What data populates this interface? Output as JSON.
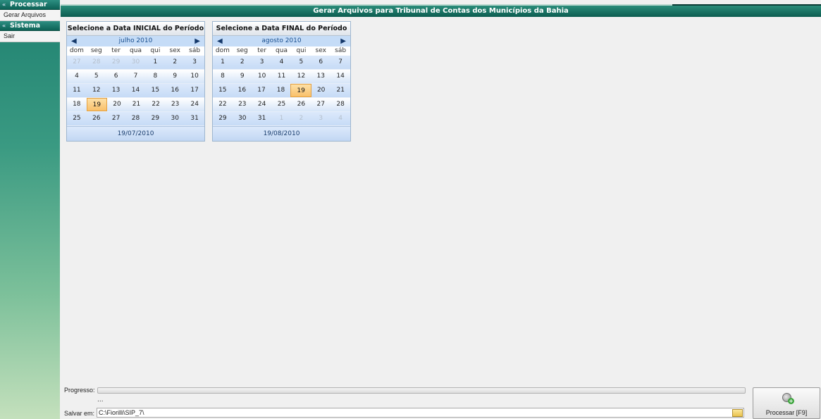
{
  "window": {
    "title": "Gerar Arquivos para Tribunal de Contas dos Municípios da Bahia"
  },
  "sidebar": {
    "groups": [
      {
        "label": "Processar",
        "items": [
          {
            "label": "Gerar Arquivos"
          }
        ]
      },
      {
        "label": "Sistema",
        "items": [
          {
            "label": "Sair"
          }
        ]
      }
    ]
  },
  "calendars": {
    "start": {
      "header": "Selecione a Data INICIAL do Período",
      "month": "julho 2010",
      "weekdays": [
        "dom",
        "seg",
        "ter",
        "qua",
        "qui",
        "sex",
        "sáb"
      ],
      "weeks": [
        [
          {
            "d": "27",
            "o": true
          },
          {
            "d": "28",
            "o": true
          },
          {
            "d": "29",
            "o": true
          },
          {
            "d": "30",
            "o": true
          },
          {
            "d": "1"
          },
          {
            "d": "2"
          },
          {
            "d": "3"
          }
        ],
        [
          {
            "d": "4"
          },
          {
            "d": "5"
          },
          {
            "d": "6"
          },
          {
            "d": "7"
          },
          {
            "d": "8"
          },
          {
            "d": "9"
          },
          {
            "d": "10"
          }
        ],
        [
          {
            "d": "11"
          },
          {
            "d": "12"
          },
          {
            "d": "13"
          },
          {
            "d": "14"
          },
          {
            "d": "15"
          },
          {
            "d": "16"
          },
          {
            "d": "17"
          }
        ],
        [
          {
            "d": "18"
          },
          {
            "d": "19",
            "s": true
          },
          {
            "d": "20"
          },
          {
            "d": "21"
          },
          {
            "d": "22"
          },
          {
            "d": "23"
          },
          {
            "d": "24"
          }
        ],
        [
          {
            "d": "25"
          },
          {
            "d": "26"
          },
          {
            "d": "27"
          },
          {
            "d": "28"
          },
          {
            "d": "29"
          },
          {
            "d": "30"
          },
          {
            "d": "31"
          }
        ]
      ],
      "selected_date": "19/07/2010"
    },
    "end": {
      "header": "Selecione a Data FINAL do Período",
      "month": "agosto 2010",
      "weekdays": [
        "dom",
        "seg",
        "ter",
        "qua",
        "qui",
        "sex",
        "sáb"
      ],
      "weeks": [
        [
          {
            "d": "1"
          },
          {
            "d": "2"
          },
          {
            "d": "3"
          },
          {
            "d": "4"
          },
          {
            "d": "5"
          },
          {
            "d": "6"
          },
          {
            "d": "7"
          }
        ],
        [
          {
            "d": "8"
          },
          {
            "d": "9"
          },
          {
            "d": "10"
          },
          {
            "d": "11"
          },
          {
            "d": "12"
          },
          {
            "d": "13"
          },
          {
            "d": "14"
          }
        ],
        [
          {
            "d": "15"
          },
          {
            "d": "16"
          },
          {
            "d": "17"
          },
          {
            "d": "18"
          },
          {
            "d": "19",
            "s": true
          },
          {
            "d": "20"
          },
          {
            "d": "21"
          }
        ],
        [
          {
            "d": "22"
          },
          {
            "d": "23"
          },
          {
            "d": "24"
          },
          {
            "d": "25"
          },
          {
            "d": "26"
          },
          {
            "d": "27"
          },
          {
            "d": "28"
          }
        ],
        [
          {
            "d": "29"
          },
          {
            "d": "30"
          },
          {
            "d": "31"
          },
          {
            "d": "1",
            "o": true
          },
          {
            "d": "2",
            "o": true
          },
          {
            "d": "3",
            "o": true
          },
          {
            "d": "4",
            "o": true
          }
        ]
      ],
      "selected_date": "19/08/2010"
    }
  },
  "bottom": {
    "progress_label": "Progresso:",
    "progress_value": 0,
    "status_text": "...",
    "save_label": "Salvar em:",
    "save_path": "C:\\Fiorilli\\SIP_7\\",
    "process_button_label": "Processar [F9]"
  },
  "icons": {
    "prev_month": "chevron-left-icon",
    "next_month": "chevron-right-icon",
    "group_collapse": "double-chevron-down-icon",
    "folder": "folder-icon",
    "process": "gear-add-icon"
  },
  "colors": {
    "title_bar": "#0c5c50",
    "sidebar_accent": "#1e8070",
    "calendar_month_bar": "#c5dcf7",
    "selected_day": "#f9c06a",
    "progress_fill": "#4fa04f"
  }
}
